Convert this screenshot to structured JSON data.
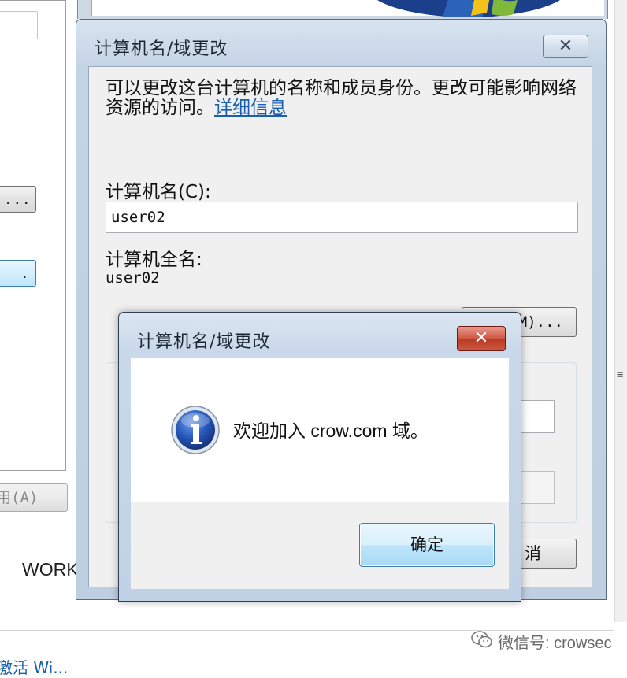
{
  "background": {
    "left_ellipsis_button": "...",
    "left_highlight_button": ".",
    "apply_button": "用(A)",
    "workgroup_label": "WORK",
    "activate_link": "激活 Wi..."
  },
  "name_dialog": {
    "title": "计算机名/域更改",
    "intro_text": "可以更改这台计算机的名称和成员身份。更改可能影响网络资源的访问。",
    "details_link": "详细信息",
    "computer_name_label": "计算机名(C):",
    "computer_name_value": "user02",
    "full_name_label": "计算机全名:",
    "full_name_value": "user02",
    "other_button_visible": "M)...",
    "cancel_button_visible": "消"
  },
  "message_box": {
    "title": "计算机名/域更改",
    "message": "欢迎加入 crow.com 域。",
    "ok_button": "确定",
    "icon": "information-icon"
  },
  "watermark": {
    "text": "微信号: crowsec",
    "icon": "wechat-icon"
  },
  "colors": {
    "link": "#1a5eb0",
    "ok_button_border": "#3c7fb1",
    "close_button_red": "#c9593e",
    "titlebar_blue": "#c5d4e5"
  }
}
